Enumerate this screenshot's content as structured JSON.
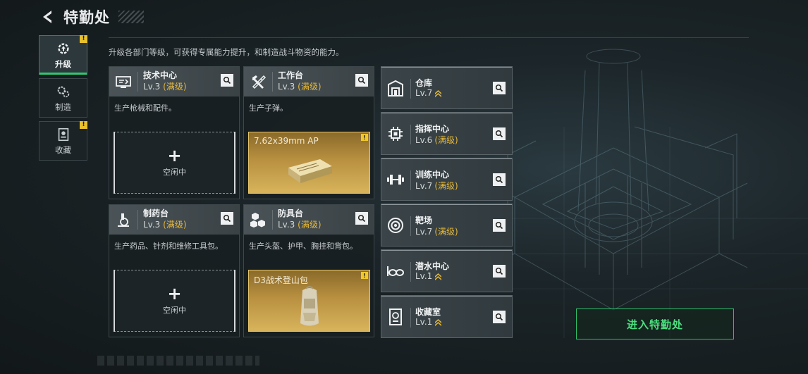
{
  "header": {
    "title": "特勤处"
  },
  "description": "升级各部门等级，可获得专属能力提升，和制造战斗物资的能力。",
  "nav": [
    {
      "label": "升级",
      "icon": "upgrade-gear-icon",
      "active": true,
      "badge": "!"
    },
    {
      "label": "制造",
      "icon": "craft-gears-icon",
      "active": false,
      "badge": ""
    },
    {
      "label": "收藏",
      "icon": "collection-frame-icon",
      "active": false,
      "badge": "!"
    }
  ],
  "workshops": [
    {
      "name": "技术中心",
      "level": "Lv.3",
      "status": "(满级)",
      "desc": "生产枪械和配件。",
      "icon": "tech-center-icon",
      "slot": {
        "state": "idle",
        "plus": "+",
        "label": "空闲中"
      }
    },
    {
      "name": "工作台",
      "level": "Lv.3",
      "status": "(满级)",
      "desc": "生产子弹。",
      "icon": "hammer-wrench-icon",
      "slot": {
        "state": "producing",
        "item": "7.62x39mm AP",
        "badge": "!"
      }
    },
    {
      "name": "制药台",
      "level": "Lv.3",
      "status": "(满级)",
      "desc": "生产药品、针剂和维修工具包。",
      "icon": "microscope-icon",
      "slot": {
        "state": "idle",
        "plus": "+",
        "label": "空闲中"
      }
    },
    {
      "name": "防具台",
      "level": "Lv.3",
      "status": "(满级)",
      "desc": "生产头盔、护甲、胸挂和背包。",
      "icon": "armor-cubes-icon",
      "slot": {
        "state": "producing",
        "item": "D3战术登山包",
        "badge": "!"
      }
    }
  ],
  "facilities": [
    {
      "name": "仓库",
      "level": "Lv.7",
      "status": "",
      "upgradable": true,
      "icon": "warehouse-icon"
    },
    {
      "name": "指挥中心",
      "level": "Lv.6",
      "status": "(满级)",
      "upgradable": false,
      "icon": "command-chip-icon"
    },
    {
      "name": "训练中心",
      "level": "Lv.7",
      "status": "(满级)",
      "upgradable": false,
      "icon": "dumbbell-icon"
    },
    {
      "name": "靶场",
      "level": "Lv.7",
      "status": "(满级)",
      "upgradable": false,
      "icon": "target-icon"
    },
    {
      "name": "潜水中心",
      "level": "Lv.1",
      "status": "",
      "upgradable": true,
      "icon": "diving-goggles-icon"
    },
    {
      "name": "收藏室",
      "level": "Lv.1",
      "status": "",
      "upgradable": true,
      "icon": "collection-room-icon"
    }
  ],
  "enter_button": "进入特勤处",
  "colors": {
    "accent_green": "#2fc872",
    "max_gold": "#e5b83a",
    "badge_yellow": "#e8c12e"
  }
}
